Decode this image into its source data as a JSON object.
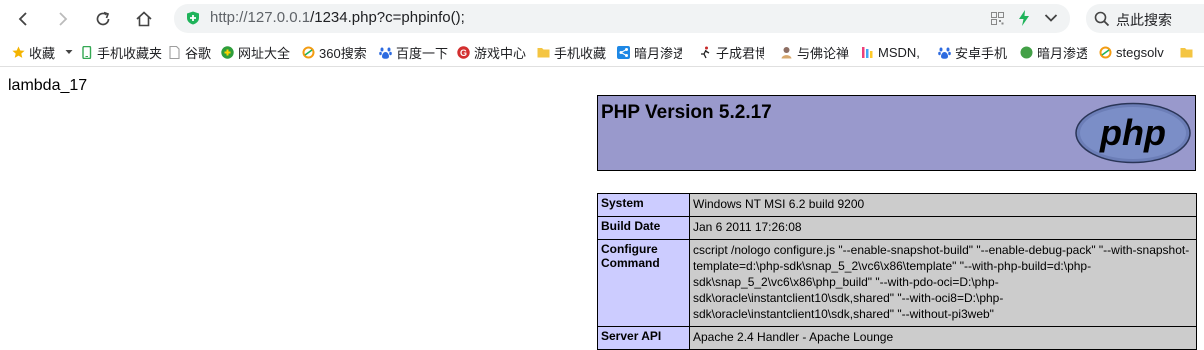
{
  "browser": {
    "url_host": "http://127.0.0.1",
    "url_path": "/1234.php?c=phpinfo();",
    "search_placeholder": "点此搜索"
  },
  "bookmarks": [
    {
      "label": "收藏",
      "icon": "star-icon",
      "color": "#f4b400"
    },
    {
      "label": "手机收藏夹",
      "icon": "phone-icon",
      "color": "#34a853"
    },
    {
      "label": "谷歌",
      "icon": "page-icon",
      "color": "#9e9e9e"
    },
    {
      "label": "网址大全",
      "icon": "nav-icon",
      "color": "#2e9e3b"
    },
    {
      "label": "360搜索",
      "icon": "search-360-icon",
      "color": "#f39c12"
    },
    {
      "label": "百度一下",
      "icon": "baidu-paw-icon",
      "color": "#2d6be0"
    },
    {
      "label": "游戏中心",
      "icon": "game-icon",
      "color": "#d32f2f"
    },
    {
      "label": "手机收藏",
      "icon": "folder-icon",
      "color": "#f4c542"
    },
    {
      "label": "暗月渗透",
      "icon": "share-icon",
      "color": "#1e88e5"
    },
    {
      "label": "子成君博",
      "icon": "runner-icon",
      "color": "#c62828"
    },
    {
      "label": "与佛论禅",
      "icon": "buddha-icon",
      "color": "#8d6e63"
    },
    {
      "label": "MSDN,",
      "icon": "msdn-icon",
      "color": "#ec407a"
    },
    {
      "label": "安卓手机",
      "icon": "baidu-paw-icon",
      "color": "#2d6be0"
    },
    {
      "label": "暗月渗透",
      "icon": "leaf-icon",
      "color": "#43a047"
    },
    {
      "label": "stegsolv",
      "icon": "search-360-icon",
      "color": "#f39c12"
    }
  ],
  "page": {
    "output_text": "lambda_17",
    "php_title": "PHP Version 5.2.17",
    "rows": [
      {
        "key": "System",
        "value": "Windows NT MSI 6.2 build 9200"
      },
      {
        "key": "Build Date",
        "value": "Jan 6 2011 17:26:08"
      },
      {
        "key": "Configure Command",
        "value": "cscript /nologo configure.js \"--enable-snapshot-build\" \"--enable-debug-pack\" \"--with-snapshot-template=d:\\php-sdk\\snap_5_2\\vc6\\x86\\template\" \"--with-php-build=d:\\php-sdk\\snap_5_2\\vc6\\x86\\php_build\" \"--with-pdo-oci=D:\\php-sdk\\oracle\\instantclient10\\sdk,shared\" \"--with-oci8=D:\\php-sdk\\oracle\\instantclient10\\sdk,shared\" \"--without-pi3web\""
      },
      {
        "key": "Server API",
        "value": "Apache 2.4 Handler - Apache Lounge"
      }
    ]
  }
}
